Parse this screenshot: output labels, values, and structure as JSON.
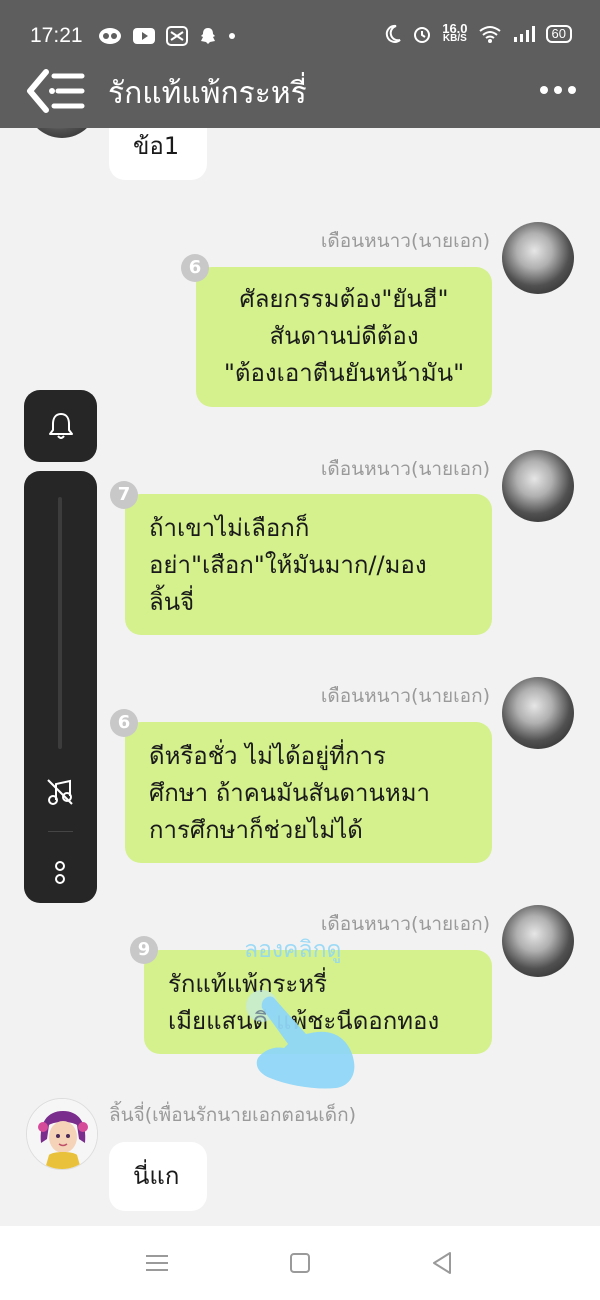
{
  "status_bar": {
    "time": "17:21",
    "network_speed_value": "16.0",
    "network_speed_unit": "KB/S",
    "battery": "60"
  },
  "header": {
    "title": "รักแท้แพ้กระหรี่"
  },
  "messages": [
    {
      "id": "m0",
      "side": "left",
      "bubble": "white",
      "lines": [
        "ข้อ1"
      ]
    },
    {
      "id": "m1",
      "side": "right",
      "sender": "เดือนหนาว(นายเอก)",
      "badge": "6",
      "lines": [
        "ศัลยกรรมต้อง\"ยันฮี\"",
        "สันดานบ่ดีต้อง",
        "\"ต้องเอาตีนยันหน้ามัน\""
      ]
    },
    {
      "id": "m2",
      "side": "right",
      "sender": "เดือนหนาว(นายเอก)",
      "badge": "7",
      "lines": [
        "ถ้าเขาไม่เลือกก็",
        "อย่า\"เสือก\"ให้มันมาก//มอง",
        "ลิ้นจี่"
      ]
    },
    {
      "id": "m3",
      "side": "right",
      "sender": "เดือนหนาว(นายเอก)",
      "badge": "6",
      "lines": [
        "ดีหรือชั่ว ไม่ได้อยู่ที่การ",
        "ศึกษา ถ้าคนมันสันดานหมา",
        "การศึกษาก็ช่วยไม่ได้"
      ]
    },
    {
      "id": "m4",
      "side": "right",
      "sender": "เดือนหนาว(นายเอก)",
      "badge": "9",
      "lines": [
        "รักแท้แพ้กระหรี่",
        "เมียแสนดี แพ้ชะนีดอกทอง"
      ]
    },
    {
      "id": "m5",
      "side": "left",
      "sender": "ลิ้นจี่(เพื่อนรักนายเอกตอนเด็ก)",
      "bubble": "white",
      "lines": [
        "นี่แก"
      ]
    }
  ],
  "hint_text": "ลองคลิกดู",
  "colors": {
    "header_bg": "#5e5e5e",
    "chat_bg": "#f2f2f2",
    "bubble_green": "#d4f18d",
    "bubble_white": "#ffffff",
    "side_panel": "#262626",
    "hint": "#8fd6f7"
  },
  "icons": {
    "status_left": [
      "owl-app-icon",
      "youtube-icon",
      "capcut-icon",
      "snapchat-ghost-icon",
      "dot-icon"
    ],
    "status_right": [
      "moon-icon",
      "alarm-icon",
      "wifi-icon",
      "signal-icon",
      "battery-icon"
    ],
    "header": [
      "back-menu-icon",
      "more-dots-icon"
    ],
    "side": [
      "bell-icon",
      "music-off-icon",
      "more-vertical-icon"
    ],
    "nav": [
      "menu-icon",
      "home-square-icon",
      "back-triangle-icon"
    ],
    "overlay": [
      "tap-hand-icon"
    ]
  }
}
